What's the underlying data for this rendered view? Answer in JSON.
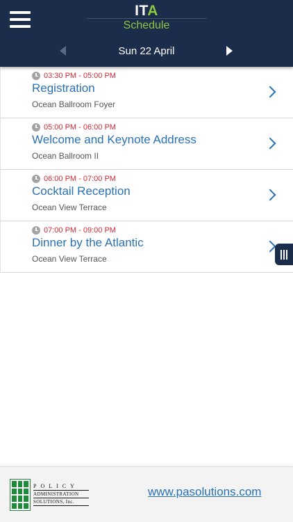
{
  "header": {
    "logo_text": "IT",
    "logo_accent": "A",
    "subtitle": "Schedule",
    "date": "Sun 22 April"
  },
  "events": [
    {
      "time": "03:30 PM - 05:00 PM",
      "title": "Registration",
      "location": "Ocean Ballroom Foyer"
    },
    {
      "time": "05:00 PM - 06:00 PM",
      "title": "Welcome and Keynote Address",
      "location": "Ocean Ballroom II"
    },
    {
      "time": "06:00 PM - 07:00 PM",
      "title": "Cocktail Reception",
      "location": "Ocean View Terrace"
    },
    {
      "time": "07:00 PM - 09:00 PM",
      "title": "Dinner by the Atlantic",
      "location": "Ocean View Terrace"
    }
  ],
  "footer": {
    "logo_line1": "POLICY",
    "logo_line2": "ADMINISTRATION",
    "logo_line3": "SOLUTIONS, Inc.",
    "link": "www.pasolutions.com"
  },
  "colors": {
    "header_bg": "#1b2d4b",
    "accent_green": "#8cc63f",
    "link_blue": "#2a71b3",
    "time_red": "#cc2a36"
  }
}
